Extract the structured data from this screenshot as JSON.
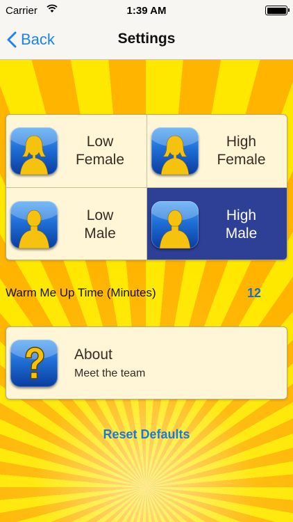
{
  "status_bar": {
    "carrier": "Carrier",
    "time": "1:39 AM",
    "wifi_icon": "wifi-icon",
    "battery_icon": "battery-full-icon"
  },
  "nav": {
    "back_label": "Back",
    "title": "Settings",
    "accent": "#1a82f7"
  },
  "voices": [
    {
      "line1": "Low",
      "line2": "Female",
      "icon": "female-silhouette-icon",
      "selected": false
    },
    {
      "line1": "High",
      "line2": "Female",
      "icon": "female-silhouette-icon",
      "selected": false
    },
    {
      "line1": "Low",
      "line2": "Male",
      "icon": "male-silhouette-icon",
      "selected": false
    },
    {
      "line1": "High",
      "line2": "Male",
      "icon": "male-silhouette-icon",
      "selected": true
    }
  ],
  "warm_up": {
    "label": "Warm Me Up Time (Minutes)",
    "value": "12"
  },
  "about": {
    "title": "About",
    "subtitle": "Meet the team",
    "icon": "question-mark-icon"
  },
  "reset_label": "Reset Defaults",
  "colors": {
    "selected_cell": "#2e3f96",
    "link": "#1a7bd4"
  }
}
